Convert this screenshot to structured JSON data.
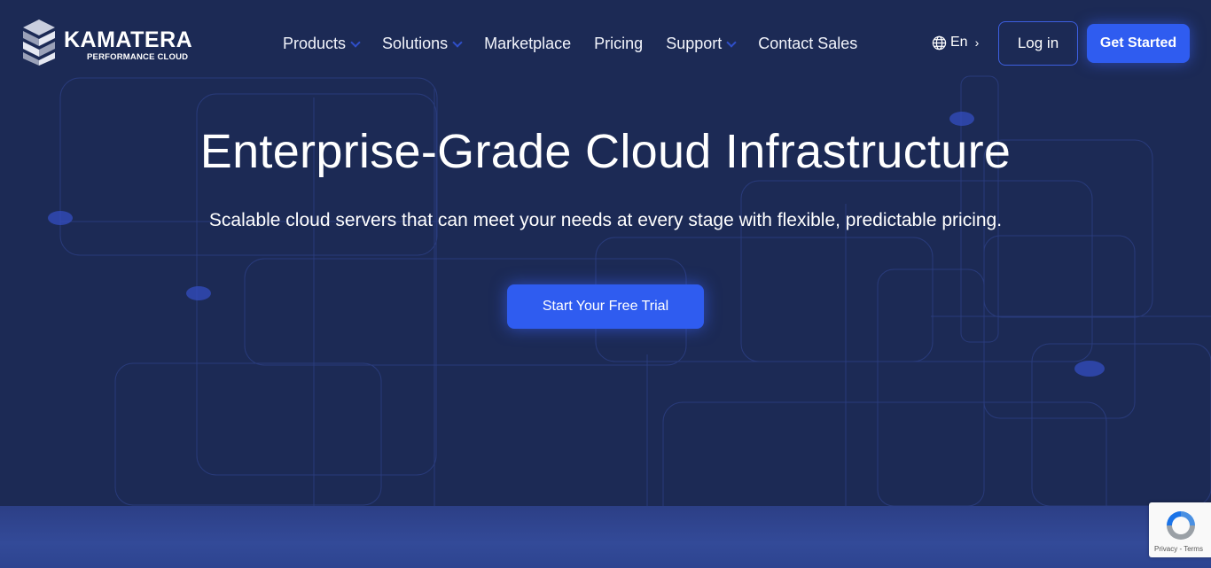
{
  "brand": {
    "name": "KAMATERA",
    "tagline": "PERFORMANCE CLOUD"
  },
  "nav": {
    "items": [
      {
        "label": "Products",
        "has_dropdown": true
      },
      {
        "label": "Solutions",
        "has_dropdown": true
      },
      {
        "label": "Marketplace",
        "has_dropdown": false
      },
      {
        "label": "Pricing",
        "has_dropdown": false
      },
      {
        "label": "Support",
        "has_dropdown": true
      },
      {
        "label": "Contact Sales",
        "has_dropdown": false
      }
    ]
  },
  "header": {
    "language": "En",
    "language_icon": "globe-icon",
    "login_label": "Log in",
    "get_started_label": "Get Started"
  },
  "hero": {
    "title": "Enterprise-Grade Cloud Infrastructure",
    "subtitle": "Scalable cloud servers that can meet your needs at every stage with flexible, predictable pricing.",
    "cta_label": "Start Your Free Trial"
  },
  "recaptcha": {
    "text": "Privacy - Terms",
    "icon": "recaptcha-icon"
  },
  "colors": {
    "background": "#1c2a55",
    "accent": "#2f5cf0",
    "line": "#3550b8"
  }
}
